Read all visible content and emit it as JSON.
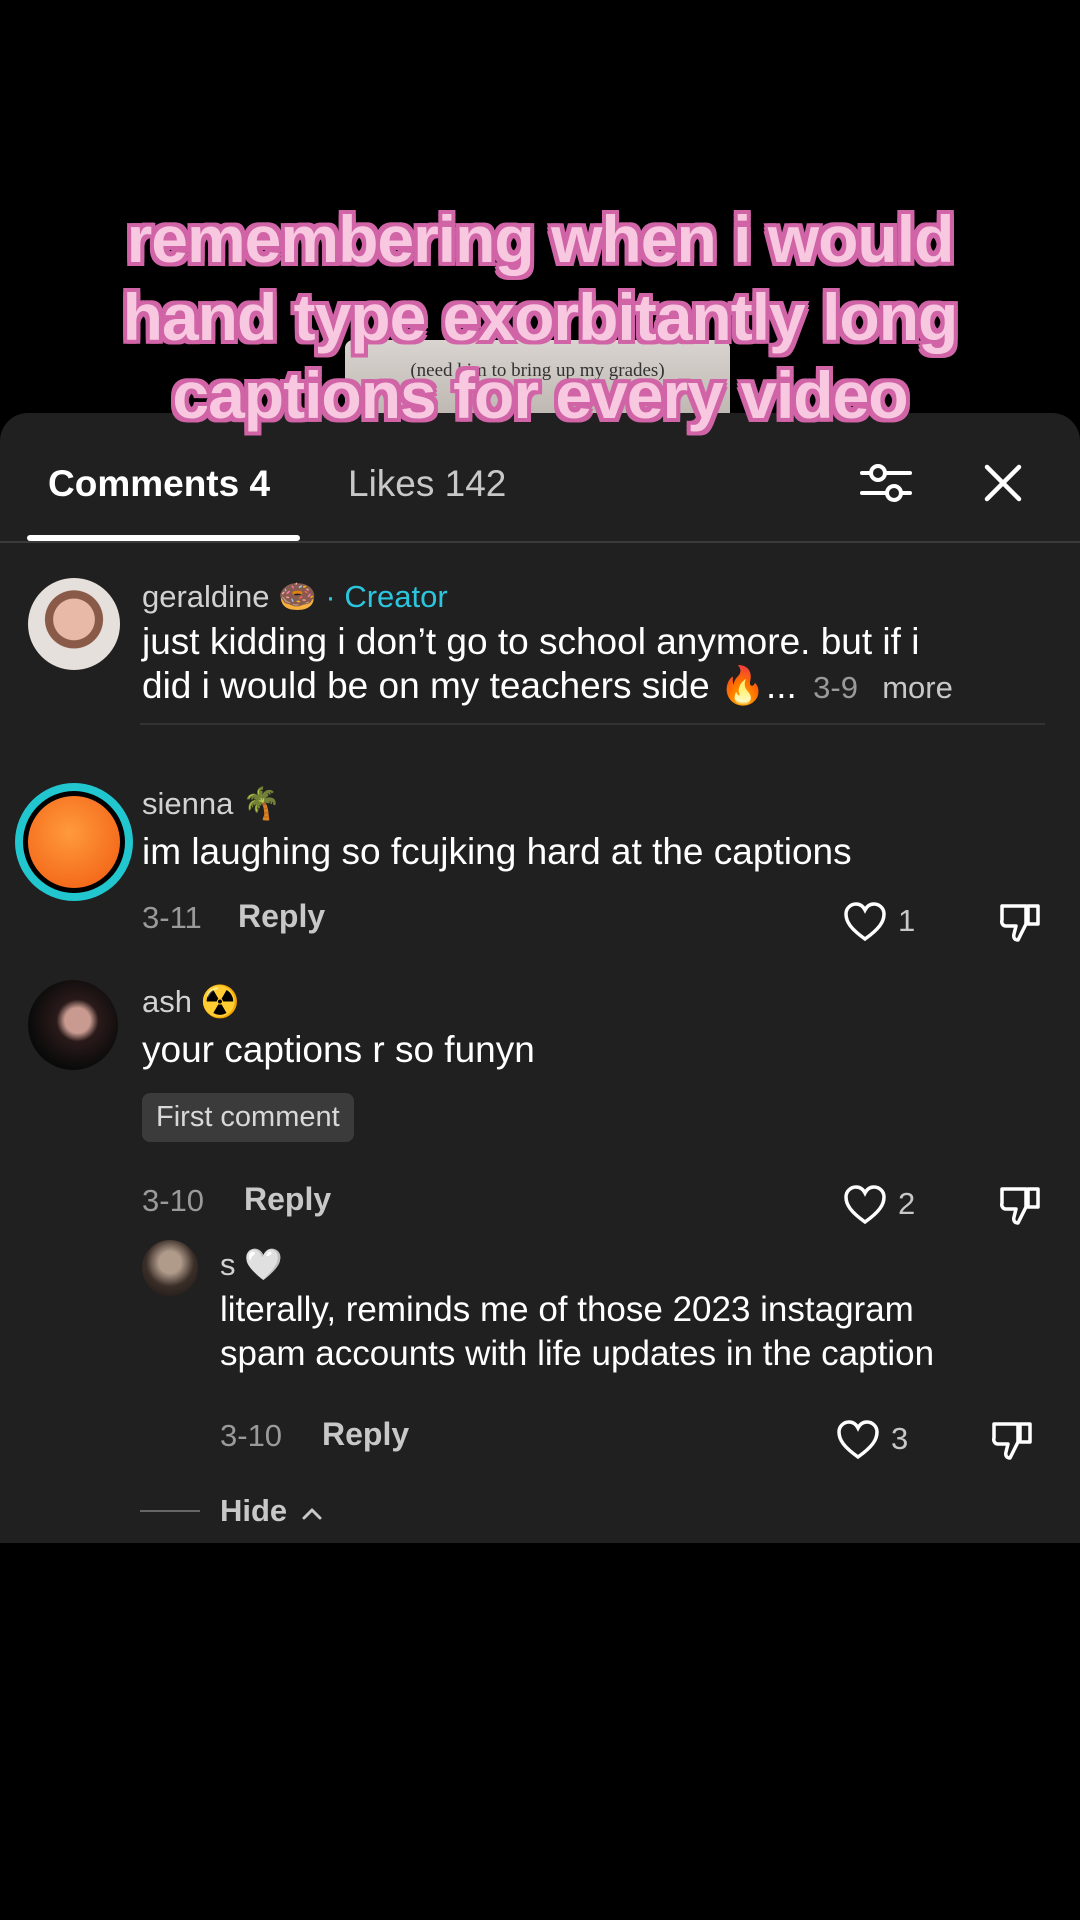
{
  "video": {
    "thumb_text": "(need him to bring up my grades)",
    "caption_lines": [
      "remembering when i would",
      "hand type exorbitantly long",
      "captions for every video"
    ]
  },
  "tabs": {
    "comments_label": "Comments 4",
    "likes_label": "Likes 142"
  },
  "comments": [
    {
      "username": "geraldine",
      "username_emoji": "🍩",
      "creator_label": "· Creator",
      "text_line1": "just kidding i don’t go to school anymore. but if i",
      "text_line2": "did i would be on my teachers side 🔥...",
      "date": "3-9",
      "more": "more"
    },
    {
      "username": "sienna",
      "username_emoji": "🌴",
      "text": "im laughing so fcujking hard at the captions",
      "date": "3-11",
      "reply": "Reply",
      "likes": "1"
    },
    {
      "username": "ash",
      "username_emoji": "☢️",
      "text": "your captions r so funyn",
      "badge": "First comment",
      "date": "3-10",
      "reply": "Reply",
      "likes": "2"
    },
    {
      "username": "s",
      "username_emoji": "🤍",
      "text_line1": "literally, reminds me of those 2023 instagram",
      "text_line2": "spam accounts with life updates in the caption",
      "date": "3-10",
      "reply": "Reply",
      "likes": "3"
    }
  ],
  "hide_label": "Hide",
  "colors": {
    "caption_fill": "#f8c8e0",
    "caption_outline": "#d064a6",
    "creator": "#2bc6de",
    "sheet": "#202020"
  }
}
